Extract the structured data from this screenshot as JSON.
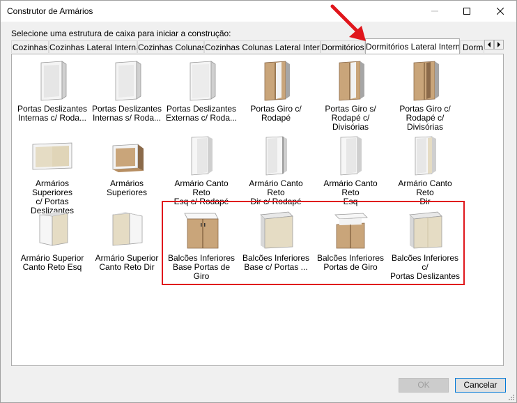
{
  "window": {
    "title": "Construtor de Armários",
    "minimize_icon": "minimize-icon",
    "maximize_icon": "maximize-icon",
    "close_icon": "close-icon"
  },
  "instruction": "Selecione uma estrutura de caixa para iniciar a construção:",
  "tabs": [
    {
      "label": "Cozinhas"
    },
    {
      "label": "Cozinhas Lateral Interna"
    },
    {
      "label": "Cozinhas Colunas"
    },
    {
      "label": "Cozinhas Colunas Lateral Interna"
    },
    {
      "label": "Dormitórios"
    },
    {
      "label": "Dormitórios Lateral Interna",
      "active": true
    },
    {
      "label": "Dormit"
    }
  ],
  "tab_scroll": {
    "left_icon": "arrow-left-icon",
    "right_icon": "arrow-right-icon"
  },
  "items": [
    {
      "l1": "Portas Deslizantes",
      "l2": "Internas c/ Roda..."
    },
    {
      "l1": "Portas Deslizantes",
      "l2": "Internas s/ Roda..."
    },
    {
      "l1": "Portas Deslizantes",
      "l2": "Externas c/ Roda..."
    },
    {
      "l1": "Portas Giro c/",
      "l2": "Rodapé"
    },
    {
      "l1": "Portas Giro s/",
      "l2": "Rodapé c/ Divisórias"
    },
    {
      "l1": "Portas Giro c/",
      "l2": "Rodapé c/ Divisórias"
    },
    {
      "l1": "Armários Superiores",
      "l2": "c/ Portas Deslizantes"
    },
    {
      "l1": "Armários Superiores",
      "l2": ""
    },
    {
      "l1": "Armário Canto Reto",
      "l2": "Esq c/ Rodapé"
    },
    {
      "l1": "Armário Canto Reto",
      "l2": "Dir c/ Rodapé"
    },
    {
      "l1": "Armário Canto Reto",
      "l2": "Esq"
    },
    {
      "l1": "Armário Canto Reto",
      "l2": "Dir"
    },
    {
      "l1": "Armário Superior",
      "l2": "Canto Reto Esq"
    },
    {
      "l1": "Armário Superior",
      "l2": "Canto Reto Dir"
    },
    {
      "l1": "Balcões Inferiores",
      "l2": "Base Portas de Giro"
    },
    {
      "l1": "Balcões Inferiores",
      "l2": "Base c/ Portas ..."
    },
    {
      "l1": "Balcões Inferiores",
      "l2": "Portas de Giro"
    },
    {
      "l1": "Balcões Inferiores c/",
      "l2": "Portas Deslizantes"
    }
  ],
  "buttons": {
    "ok": "OK",
    "cancel": "Cancelar"
  },
  "colors": {
    "highlight": "#e0161c",
    "wood": "#c9a57a",
    "wood_dark": "#8b6a4a",
    "beige": "#e5dcc4",
    "white_panel": "#f7f7f7",
    "accent": "#0078d7"
  }
}
